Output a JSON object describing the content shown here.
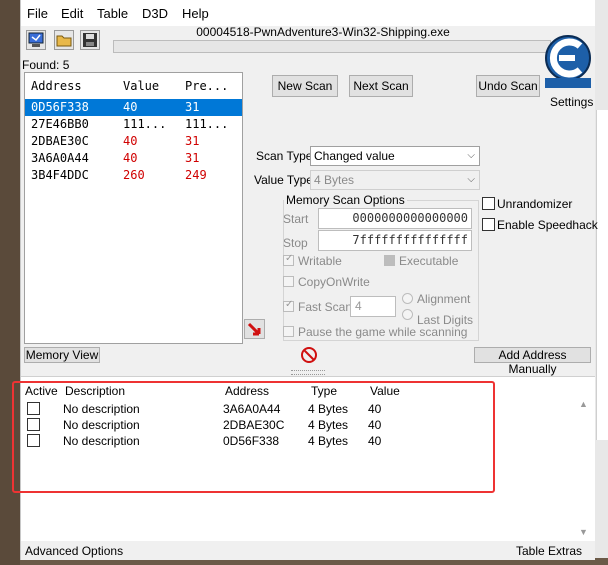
{
  "menu": {
    "file": "File",
    "edit": "Edit",
    "table": "Table",
    "d3d": "D3D",
    "help": "Help"
  },
  "process_title": "00004518-PwnAdventure3-Win32-Shipping.exe",
  "settings_label": "Settings",
  "found_label": "Found: 5",
  "results": {
    "headers": [
      "Address",
      "Value",
      "Pre..."
    ],
    "rows": [
      {
        "address": "0D56F338",
        "value": "40",
        "previous": "31",
        "selected": true
      },
      {
        "address": "27E46BB0",
        "value": "111...",
        "previous": "111...",
        "selected": false
      },
      {
        "address": "2DBAE30C",
        "value": "40",
        "previous": "31",
        "selected": false
      },
      {
        "address": "3A6A0A44",
        "value": "40",
        "previous": "31",
        "selected": false
      },
      {
        "address": "3B4F4DDC",
        "value": "260",
        "previous": "249",
        "selected": false
      }
    ]
  },
  "buttons": {
    "new_scan": "New Scan",
    "next_scan": "Next Scan",
    "undo_scan": "Undo Scan",
    "memory_view": "Memory View",
    "add_address": "Add Address Manually"
  },
  "scan_type": {
    "label": "Scan Type",
    "value": "Changed value"
  },
  "value_type": {
    "label": "Value Type",
    "value": "4 Bytes"
  },
  "memory_options": {
    "title": "Memory Scan Options",
    "start_label": "Start",
    "start_value": "0000000000000000",
    "stop_label": "Stop",
    "stop_value": "7fffffffffffffff",
    "writable": "Writable",
    "executable": "Executable",
    "copyonwrite": "CopyOnWrite",
    "fast_scan": "Fast Scan",
    "fast_scan_value": "4",
    "alignment": "Alignment",
    "last_digits": "Last Digits",
    "pause": "Pause the game while scanning"
  },
  "unrandomizer": "Unrandomizer",
  "speedhack": "Enable Speedhack",
  "address_list": {
    "headers": {
      "active": "Active",
      "description": "Description",
      "address": "Address",
      "type": "Type",
      "value": "Value"
    },
    "rows": [
      {
        "description": "No description",
        "address": "3A6A0A44",
        "type": "4 Bytes",
        "value": "40"
      },
      {
        "description": "No description",
        "address": "2DBAE30C",
        "type": "4 Bytes",
        "value": "40"
      },
      {
        "description": "No description",
        "address": "0D56F338",
        "type": "4 Bytes",
        "value": "40"
      }
    ]
  },
  "status": {
    "advanced": "Advanced Options",
    "table_extras": "Table Extras"
  },
  "colors": {
    "selection": "#0078d7",
    "changed_value": "#d00000",
    "highlight_box": "#e33333"
  }
}
